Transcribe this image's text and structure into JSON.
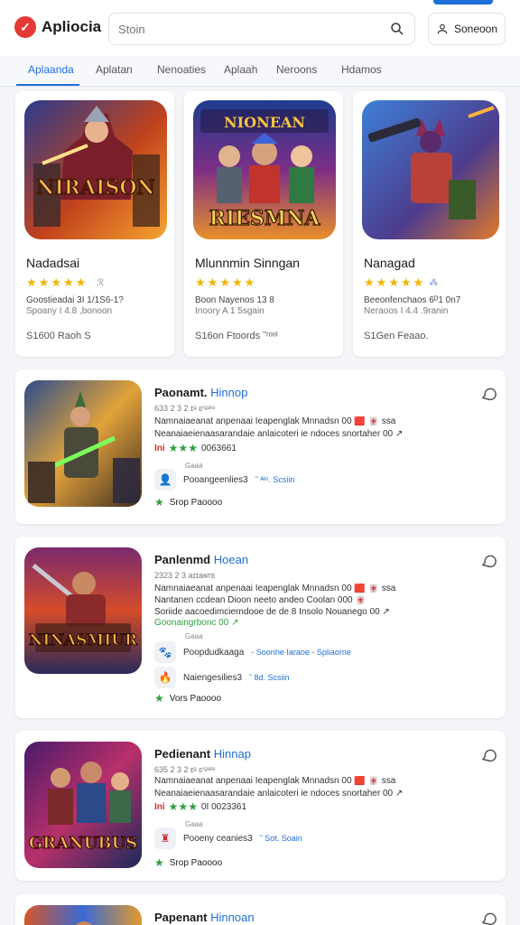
{
  "app": {
    "brand": "Apliocia",
    "logo_glyph": "✓"
  },
  "search": {
    "placeholder": "Stoin"
  },
  "header": {
    "signin_label": "Soneoon"
  },
  "tabs": [
    {
      "label": "Aplaanda",
      "active": true
    },
    {
      "label": "Aplatan"
    },
    {
      "label": "Nenoaties"
    },
    {
      "label": "Aplaah"
    },
    {
      "label": "Neroons"
    },
    {
      "label": "Hdamos"
    }
  ],
  "featured": [
    {
      "title": "Nadadsai",
      "art_text": "NIRAISON",
      "extra": "ℛ",
      "line1": "Goostieadai 3I 1/1S6-1?",
      "line2": "Spoany I 4.8 ,bonoon",
      "footer": "S1600 Raoh S"
    },
    {
      "title": "Mlunnmin Sinngan",
      "art_text": "RIESMNA",
      "art_top": "NIONEAN",
      "extra": "",
      "line1": "Boon Nayenos 13 8",
      "line2": "Inoory A 1 5sgain",
      "footer": "S16on Ftoords ˜ʳᵒᵒˡ"
    },
    {
      "title": "Nanagad",
      "art_text": "",
      "extra": "⁂",
      "line1": "Beeonfenchaos 6ᴰ1 0n7",
      "line2": "Neraoos I 4.4 .9ranin",
      "footer": "S1Gen Feaao."
    }
  ],
  "list": [
    {
      "title": "Paonamt.",
      "title_accent": "Hinnop",
      "meta": "633 2 3 2 ɪᵍ ɛʳᵍᵃᵗᵉ",
      "desc1": "Namnaiaeanat anpenaai Ieapenglak Mnnadsn 00 🟥 🀄 ssa",
      "desc2": "Neanaiaeienaasarandaie anlaicoteri ie ndoces snortaher 00 ↗",
      "desc3": "",
      "rating_prefix": "Ini",
      "rating_num": "0063661",
      "dev_label": "Gaaa",
      "dev_name": "Pooangeenlies3",
      "dev_tags": "˜ ᴬᵏᵗ.  Scsiin",
      "price": "Srop Paoooo",
      "art_text": ""
    },
    {
      "title": "Panlenmd",
      "title_accent": "Hoean",
      "meta": "2323 2 3 aɪɪaɴᴛᴇ",
      "desc1": "Namnaiaeanat anpenaai Ieapenglak Mnnadsn 00 🟥 🀄 ssa",
      "desc2": "Nantanen ccdean Dioon neeto andeo Coolan 000 🀄",
      "desc3": "Soriide aacoedimcierndooe de de 8 Insolo Nouanego 00 ↗",
      "desc4": "Goonaingrbonc 00 ↗",
      "rating_prefix": "",
      "rating_num": "",
      "dev_label": "Gaaa",
      "dev_name": "Poopdudkaaga",
      "dev_tags": "- Soonhe Iaraoe - Spliaorne",
      "dev2_name": "Naiengesilies3",
      "dev2_tags": "˜ 8d.  Scsiin",
      "price": "Vors Paoooo",
      "art_text": "NINASMIUR"
    },
    {
      "title": "Pedienant",
      "title_accent": "Hinnap",
      "meta": "635 2 3 2 ɪᵍ ɛʳᵍᵃᵗᵉ",
      "desc1": "Namnaiaeanat anpenaai Ieapenglak Mnnadsn 00 🟥 🀄 ssa",
      "desc2": "Neanaiaeienaasarandaie anlaicoteri ie ndoces snortaher 00 ↗",
      "desc3": "",
      "rating_prefix": "Ini",
      "rating_num": "0I 0023361",
      "dev_label": "Gaaa",
      "dev_name": "Pooeny ceanies3",
      "dev_tags": "˜ Sot.  Soain",
      "price": "Srop Paoooo",
      "art_text": "GRANUBUS"
    },
    {
      "title": "Papenant",
      "title_accent": "Hinnoan",
      "meta": "",
      "art_text": ""
    }
  ],
  "colors": {
    "accent": "#1e6fd9",
    "star": "#f4b400",
    "rating_green": "#2e9e44",
    "brand_red": "#e53935"
  }
}
